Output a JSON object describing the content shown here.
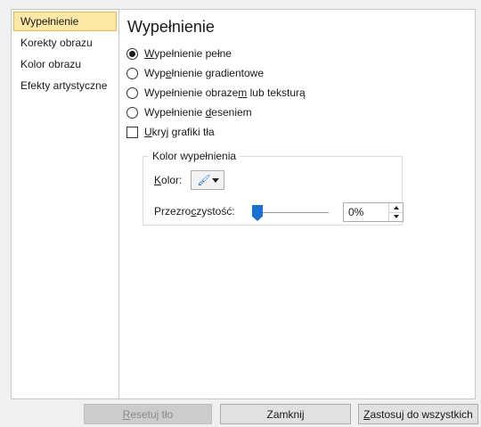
{
  "sidebar": {
    "items": [
      {
        "label": "Wypełnienie"
      },
      {
        "label": "Korekty obrazu"
      },
      {
        "label": "Kolor obrazu"
      },
      {
        "label": "Efekty artystyczne"
      }
    ],
    "active_index": 0
  },
  "main": {
    "title": "Wypełnienie",
    "options": [
      {
        "pre": "",
        "key": "W",
        "post": "ypełnienie pełne",
        "selected": true
      },
      {
        "pre": "Wyp",
        "key": "e",
        "post": "łnienie gradientowe",
        "selected": false
      },
      {
        "pre": "Wypełnienie obraze",
        "key": "m",
        "post": " lub teksturą",
        "selected": false
      },
      {
        "pre": "Wypełnienie ",
        "key": "d",
        "post": "eseniem",
        "selected": false
      }
    ],
    "hide_background": {
      "key": "U",
      "post": "kryj grafiki tła",
      "checked": false
    },
    "color_group": {
      "title": "Kolor wypełnienia",
      "color_label_key": "K",
      "color_label_post": "olor:",
      "transparency_label_pre": "Przezro",
      "transparency_label_key": "c",
      "transparency_label_post": "zystość:",
      "transparency_value": "0%",
      "transparency_level": 0
    }
  },
  "footer": {
    "reset_key": "R",
    "reset_post": "esetuj tło",
    "close_label": "Zamknij",
    "apply_key": "Z",
    "apply_post": "astosuj do wszystkich"
  },
  "colors": {
    "active_item_bg": "#fde8a6",
    "active_item_border": "#e7b85b",
    "slider_thumb": "#1a6fd1"
  },
  "icons": {
    "color_button": "paint-bucket-icon",
    "dropdown": "chevron-down-icon"
  }
}
